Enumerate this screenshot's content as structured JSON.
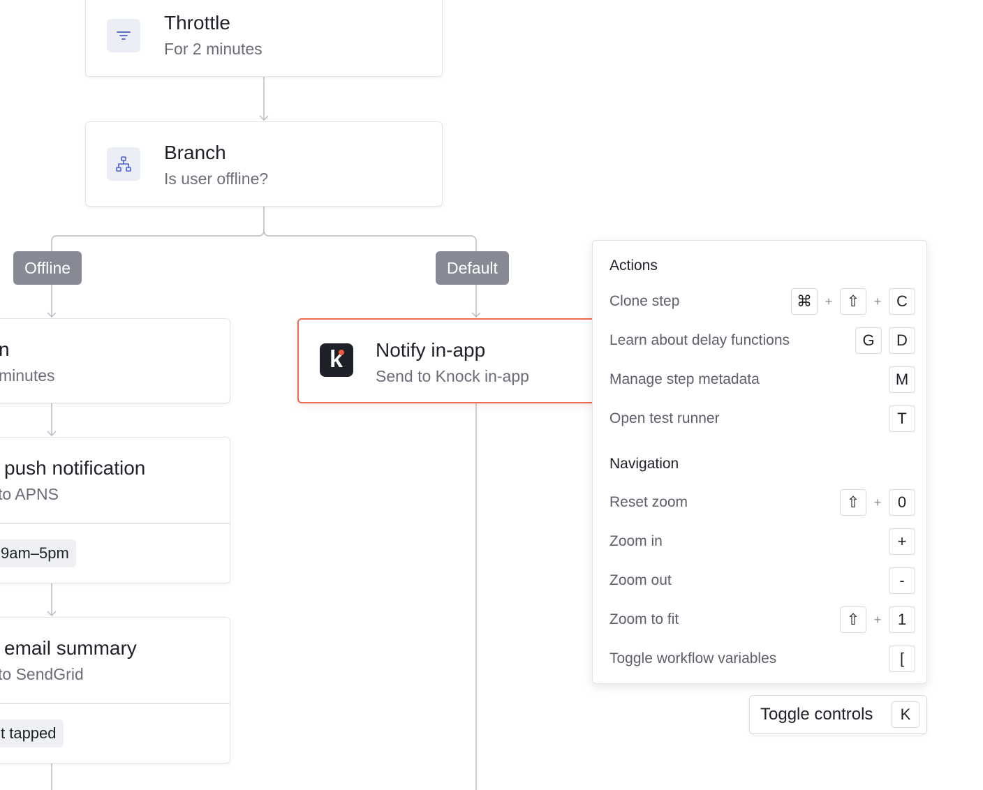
{
  "workflow": {
    "throttle": {
      "title": "Throttle",
      "subtitle": "For 2 minutes",
      "icon": "filter-icon"
    },
    "branch": {
      "title": "Branch",
      "subtitle": "Is user offline?",
      "icon": "branch-icon"
    },
    "branch_labels": {
      "offline": "Offline",
      "default": "Default"
    },
    "left_delay": {
      "title_fragment": "n",
      "subtitle_fragment": "minutes"
    },
    "left_push": {
      "title_fragment": "push notification",
      "subtitle_fragment": "to APNS",
      "chip_fragment": "9am–5pm"
    },
    "left_email": {
      "title_fragment": "email summary",
      "subtitle_fragment": "to SendGrid",
      "chip_fragment": "t tapped"
    },
    "notify": {
      "title": "Notify in-app",
      "subtitle": "Send to Knock in-app",
      "icon": "knock-logo-icon",
      "logo_letter": "k"
    }
  },
  "shortcuts": {
    "actions_heading": "Actions",
    "actions": [
      {
        "label": "Clone step",
        "keys": [
          "⌘",
          "+",
          "⇧",
          "+",
          "C"
        ]
      },
      {
        "label": "Learn about delay functions",
        "keys": [
          "G",
          "D"
        ]
      },
      {
        "label": "Manage step metadata",
        "keys": [
          "M"
        ]
      },
      {
        "label": "Open test runner",
        "keys": [
          "T"
        ]
      }
    ],
    "navigation_heading": "Navigation",
    "navigation": [
      {
        "label": "Reset zoom",
        "keys": [
          "⇧",
          "+",
          "0"
        ]
      },
      {
        "label": "Zoom in",
        "keys": [
          "+"
        ]
      },
      {
        "label": "Zoom out",
        "keys": [
          "-"
        ]
      },
      {
        "label": "Zoom to fit",
        "keys": [
          "⇧",
          "+",
          "1"
        ]
      },
      {
        "label": "Toggle workflow variables",
        "keys": [
          "["
        ]
      }
    ]
  },
  "toggle_controls": {
    "label": "Toggle controls",
    "key": "K"
  },
  "colors": {
    "accent": "#ee6a50",
    "branch_label_bg": "#878a94",
    "icon_blue": "#4a5bd1",
    "logo_red": "#ee5a3c"
  }
}
